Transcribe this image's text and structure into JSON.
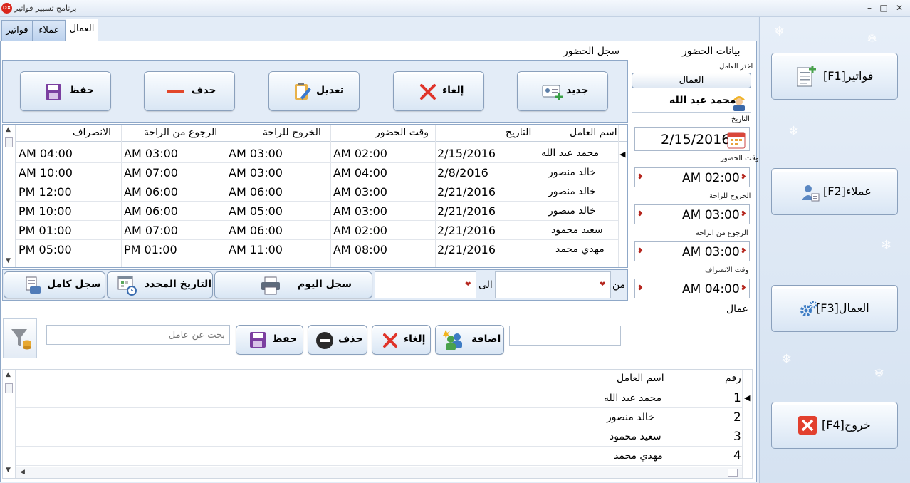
{
  "window": {
    "title": "برنامج تسيير فواتير",
    "app_icon_text": "DX",
    "minimize": "–",
    "maximize": "□",
    "close": "✕"
  },
  "tabs": [
    {
      "label": "فواتير"
    },
    {
      "label": "عملاء"
    },
    {
      "label": "العمال"
    }
  ],
  "attendance_log": {
    "title": "سجل الحضور",
    "buttons": {
      "new": "جديد",
      "cancel": "إلغاء",
      "edit": "تعديل",
      "delete": "حذف",
      "save": "حفظ"
    },
    "columns": [
      "اسم العامل",
      "التاريخ",
      "وقت الحضور",
      "الخروج للراحة",
      "الرجوع من الراحة",
      "الانصراف"
    ],
    "rows": [
      {
        "name": "محمد عبد الله",
        "date": "2/15/2016",
        "arrive": "AM 02:00",
        "break_out": "AM 03:00",
        "break_in": "AM 03:00",
        "leave": "AM 04:00"
      },
      {
        "name": "خالد منصور",
        "date": "2/8/2016",
        "arrive": "AM 04:00",
        "break_out": "AM 03:00",
        "break_in": "AM 07:00",
        "leave": "AM 10:00"
      },
      {
        "name": "خالد منصور",
        "date": "2/21/2016",
        "arrive": "AM 03:00",
        "break_out": "AM 06:00",
        "break_in": "AM 06:00",
        "leave": "PM 12:00"
      },
      {
        "name": "خالد منصور",
        "date": "2/21/2016",
        "arrive": "AM 03:00",
        "break_out": "AM 05:00",
        "break_in": "AM 06:00",
        "leave": "PM 10:00"
      },
      {
        "name": "سعيد محمود",
        "date": "2/21/2016",
        "arrive": "AM 02:00",
        "break_out": "AM 06:00",
        "break_in": "AM 07:00",
        "leave": "PM 01:00"
      },
      {
        "name": "مهدي محمد",
        "date": "2/21/2016",
        "arrive": "AM 08:00",
        "break_out": "AM 11:00",
        "break_in": "PM 01:00",
        "leave": "PM 05:00"
      }
    ],
    "filter": {
      "from_label": "من",
      "to_label": "الى",
      "today_log": "سجل اليوم",
      "selected_date": "التاريخ المحدد",
      "full_log": "سجل كامل"
    }
  },
  "attendance_data": {
    "title": "بيانات الحضور",
    "choose_worker_label": "اختر العامل",
    "workers_button": "العمال",
    "selected_worker": "محمد عبد الله",
    "date_label": "التاريخ",
    "date_value": "2/15/2016",
    "arrive_label": "وقت الحضور",
    "arrive_value": "AM 02:00",
    "break_out_label": "الخروج للراحة",
    "break_out_value": "AM 03:00",
    "break_in_label": "الرجوع من الراحة",
    "break_in_value": "AM 03:00",
    "leave_label": "وقت الانصراف",
    "leave_value": "AM 04:00"
  },
  "workers": {
    "title": "عمال",
    "add": "اضافة",
    "cancel": "إلغاء",
    "delete": "حذف",
    "save": "حفظ",
    "search_placeholder": "بحث عن عامل",
    "columns": [
      "رقم",
      "اسم العامل"
    ],
    "rows": [
      {
        "id": "1",
        "name": "محمد عبد الله"
      },
      {
        "id": "2",
        "name": "خالد منصور"
      },
      {
        "id": "3",
        "name": "سعيد محمود"
      },
      {
        "id": "4",
        "name": "مهدي محمد"
      }
    ]
  },
  "side_menu": [
    {
      "label": "[F1]فواتير"
    },
    {
      "label": "[F2]عملاء"
    },
    {
      "label": "[F3]العمال"
    },
    {
      "label": "[F4]خروج"
    }
  ]
}
